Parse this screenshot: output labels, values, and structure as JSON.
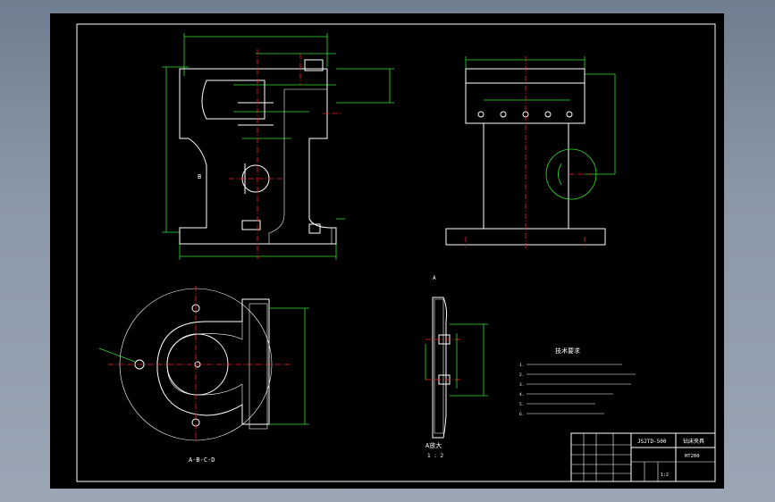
{
  "colors": {
    "background": "#000000",
    "outline": "#ffffff",
    "dimension": "#2fe02f",
    "centerline": "#ff2020",
    "chrome": "#7f8c9c"
  },
  "views": {
    "front_section_label": "B",
    "bottom_section_label": "A-B-C-D",
    "detail_label": "A",
    "detail_title": "A放大",
    "detail_scale": "1 : 2"
  },
  "notes": {
    "title": "技术要求",
    "lines": [
      "1.",
      "2.",
      "3.",
      "4.",
      "5.",
      "6."
    ]
  },
  "title_block": {
    "drawing_no": "JS2TD-500",
    "name": "钻床夹具",
    "material": "HT200",
    "scale": "1:2"
  }
}
